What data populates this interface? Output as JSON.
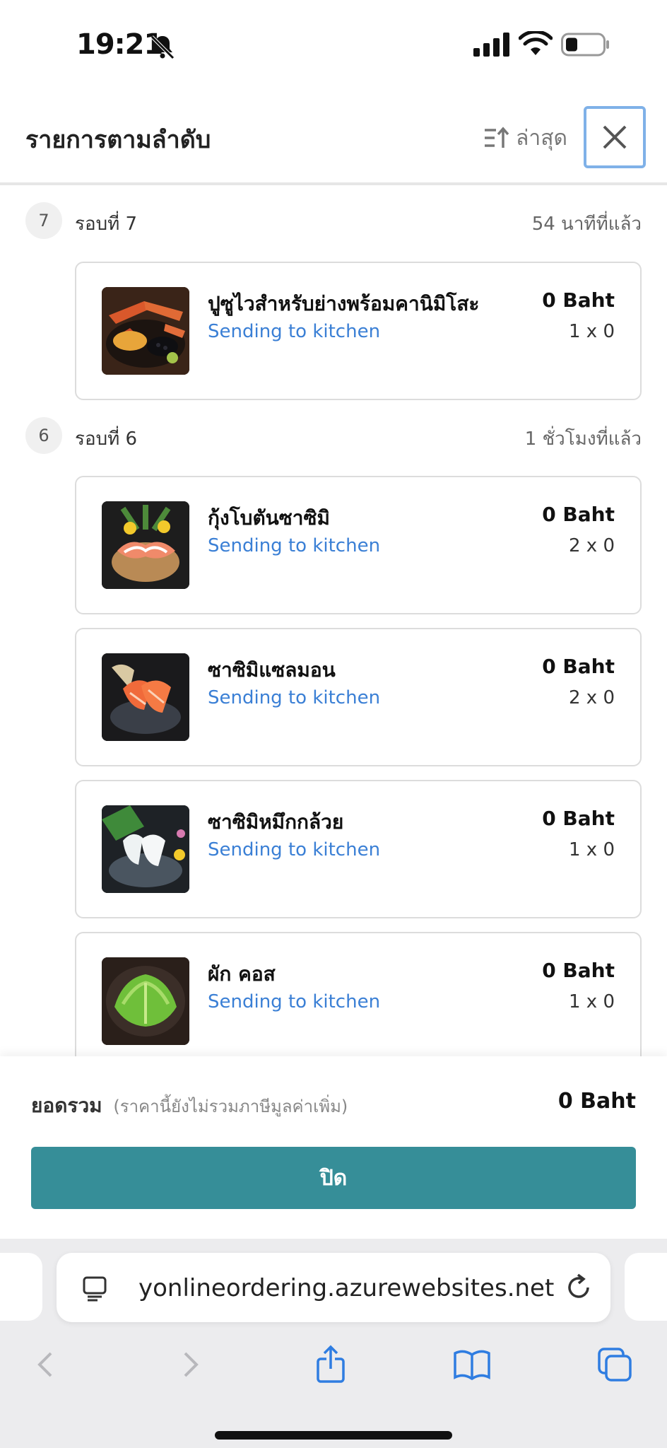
{
  "status_bar": {
    "time": "19:21"
  },
  "header": {
    "title": "รายการตามลำดับ",
    "sort_label": "ล่าสุด"
  },
  "rounds": [
    {
      "number": "7",
      "label": "รอบที่ 7",
      "time_ago": "54 นาทีที่แล้ว",
      "items": [
        {
          "name": "ปูซูไวสำหรับย่างพร้อมคานิมิโสะ",
          "status": "Sending to kitchen",
          "price": "0 Baht",
          "qty": "1 x 0",
          "image": "crab-dish"
        }
      ]
    },
    {
      "number": "6",
      "label": "รอบที่ 6",
      "time_ago": "1 ชั่วโมงที่แล้ว",
      "items": [
        {
          "name": "กุ้งโบตันซาซิมิ",
          "status": "Sending to kitchen",
          "price": "0 Baht",
          "qty": "2 x 0",
          "image": "shrimp-sashimi"
        },
        {
          "name": "ซาซิมิแซลมอน",
          "status": "Sending to kitchen",
          "price": "0 Baht",
          "qty": "2 x 0",
          "image": "salmon-sashimi"
        },
        {
          "name": "ซาซิมิหมึกกล้วย",
          "status": "Sending to kitchen",
          "price": "0 Baht",
          "qty": "1 x 0",
          "image": "squid-sashimi"
        },
        {
          "name": "ผัก คอส",
          "status": "Sending to kitchen",
          "price": "0 Baht",
          "qty": "1 x 0",
          "image": "cos-lettuce"
        }
      ]
    }
  ],
  "footer": {
    "total_label": "ยอดรวม",
    "total_note": "(ราคานี้ยังไม่รวมภาษีมูลค่าเพิ่ม)",
    "total_value": "0 Baht",
    "close_button": "ปิด"
  },
  "browser": {
    "url": "yonlineordering.azurewebsites.net"
  },
  "colors": {
    "accent": "#368e98",
    "status_blue": "#3a7fd5",
    "focus_border": "#7fb1e8"
  }
}
